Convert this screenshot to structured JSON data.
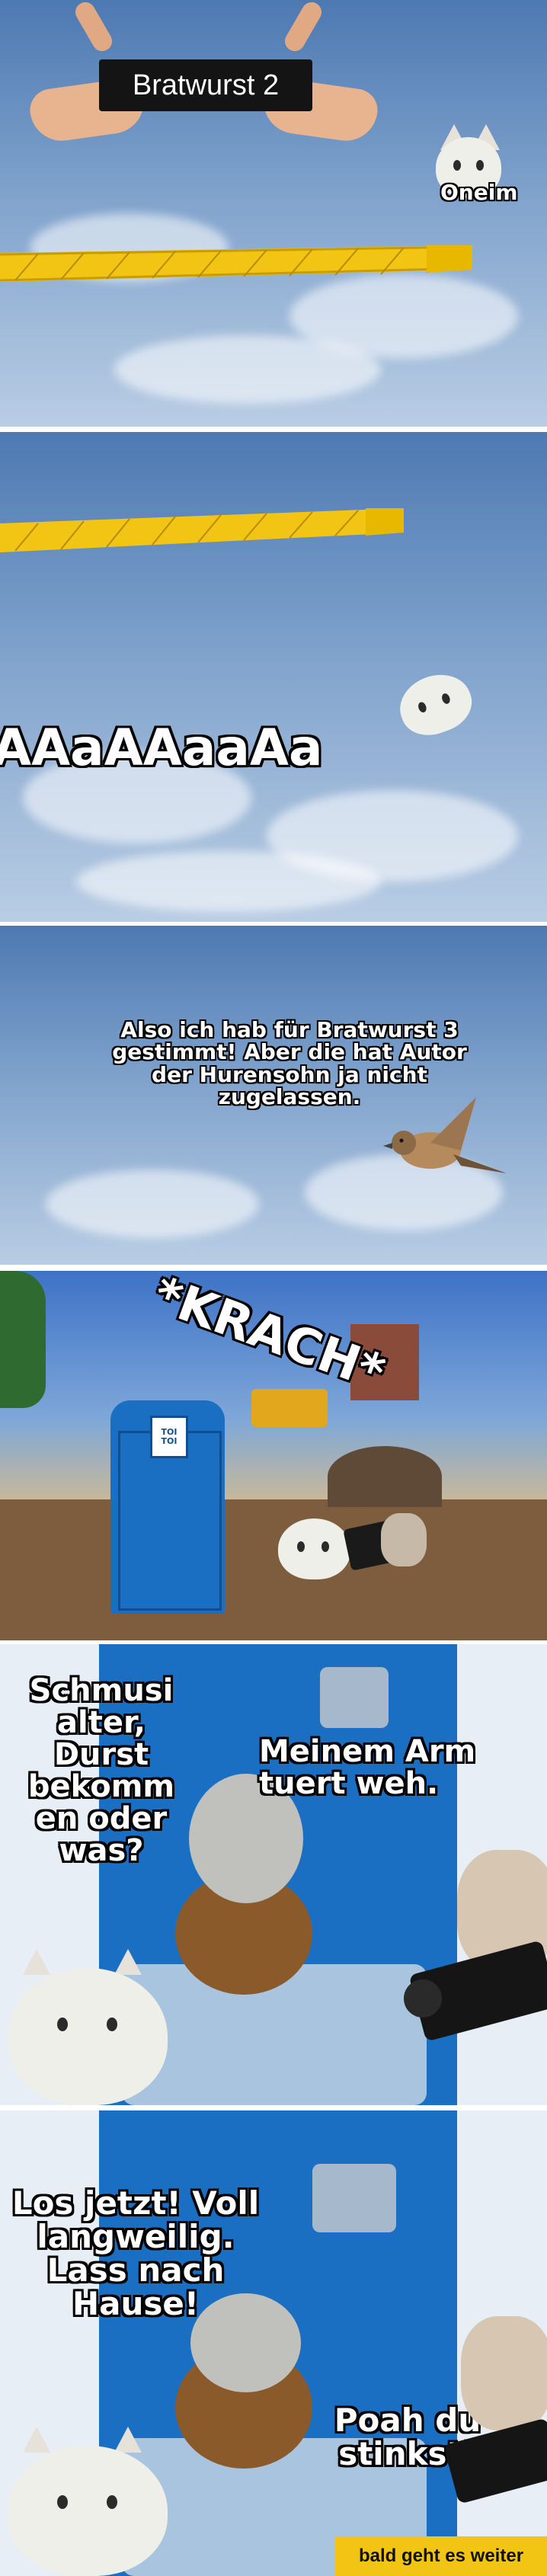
{
  "panel1": {
    "title_box": "Bratwurst 2",
    "cat_label": "Oneim"
  },
  "panel2": {
    "scream": "AAaAAaaAa"
  },
  "panel3": {
    "speech": "Also ich hab für Bratwurst 3 gestimmt! Aber die hat Autor der Hurensohn ja nicht zugelassen."
  },
  "panel4": {
    "sign": "TOI TOI",
    "sound": "*KRACH*"
  },
  "panel5": {
    "left_text": "Schmusi alter, Durst bekomm en oder was?",
    "right_text": "Meinem Arm tuert weh."
  },
  "panel6": {
    "left_text": "Los jetzt! Voll langweilig. Lass nach Hause!",
    "right_text": "Poah du stinkst!",
    "footer_badge": "bald geht es weiter"
  },
  "colors": {
    "sky": "#6f95c4",
    "crane": "#f2c414",
    "toilet": "#1b6fc2",
    "badge": "#f2c414"
  }
}
